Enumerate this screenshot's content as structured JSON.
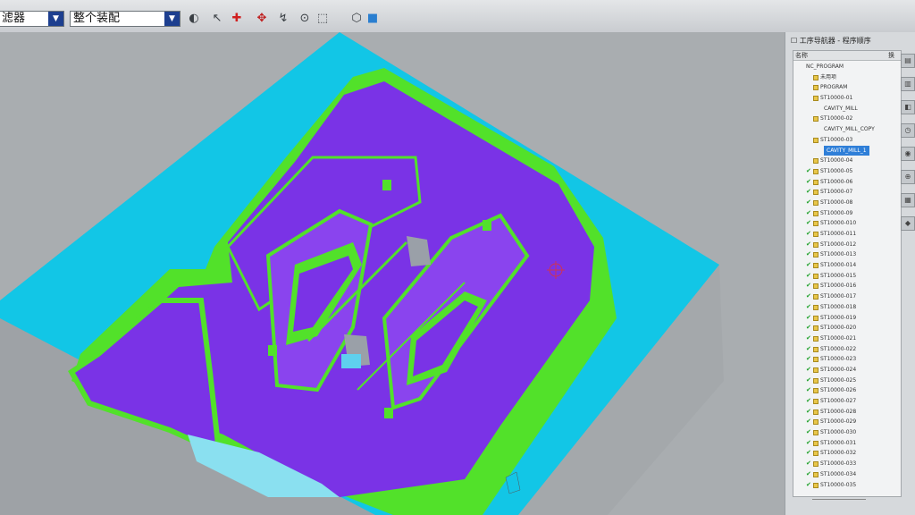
{
  "toolbar": {
    "filter_combo": "选择过滤器",
    "filter_combo_visible": "滤器",
    "scope_combo": "整个装配"
  },
  "icons": [
    "render-icon",
    "select-arrow-icon",
    "snap-point-icon",
    "move-icon",
    "snap-icon",
    "view-center-icon",
    "box-select-icon",
    "view-cube-icon"
  ],
  "navigator": {
    "title": "工序导航器 - 程序顺序",
    "col_name": "名称",
    "col_flag": "换",
    "rows": [
      {
        "label": "NC_PROGRAM",
        "indent": 0,
        "check": "",
        "folder": false
      },
      {
        "label": "未用项",
        "indent": 1,
        "check": "",
        "folder": true
      },
      {
        "label": "PROGRAM",
        "indent": 1,
        "check": "",
        "folder": true
      },
      {
        "label": "ST10000-01",
        "indent": 1,
        "check": "",
        "folder": true
      },
      {
        "label": "CAVITY_MILL",
        "indent": 2,
        "check": "",
        "folder": false
      },
      {
        "label": "ST10000-02",
        "indent": 1,
        "check": "",
        "folder": true
      },
      {
        "label": "CAVITY_MILL_COPY",
        "indent": 2,
        "check": "",
        "folder": false
      },
      {
        "label": "ST10000-03",
        "indent": 1,
        "check": "",
        "folder": true
      },
      {
        "label": "CAVITY_MILL_1",
        "indent": 2,
        "check": "",
        "folder": false,
        "selected": true
      },
      {
        "label": "ST10000-04",
        "indent": 1,
        "check": "",
        "folder": true
      },
      {
        "label": "ST10000-05",
        "indent": 1,
        "check": "✔",
        "folder": true
      },
      {
        "label": "ST10000-06",
        "indent": 1,
        "check": "✔",
        "folder": true
      },
      {
        "label": "ST10000-07",
        "indent": 1,
        "check": "✔",
        "folder": true
      },
      {
        "label": "ST10000-08",
        "indent": 1,
        "check": "✔",
        "folder": true
      },
      {
        "label": "ST10000-09",
        "indent": 1,
        "check": "✔",
        "folder": true
      },
      {
        "label": "ST10000-010",
        "indent": 1,
        "check": "✔",
        "folder": true
      },
      {
        "label": "ST10000-011",
        "indent": 1,
        "check": "✔",
        "folder": true
      },
      {
        "label": "ST10000-012",
        "indent": 1,
        "check": "✔",
        "folder": true
      },
      {
        "label": "ST10000-013",
        "indent": 1,
        "check": "✔",
        "folder": true
      },
      {
        "label": "ST10000-014",
        "indent": 1,
        "check": "✔",
        "folder": true
      },
      {
        "label": "ST10000-015",
        "indent": 1,
        "check": "✔",
        "folder": true
      },
      {
        "label": "ST10000-016",
        "indent": 1,
        "check": "✔",
        "folder": true
      },
      {
        "label": "ST10000-017",
        "indent": 1,
        "check": "✔",
        "folder": true
      },
      {
        "label": "ST10000-018",
        "indent": 1,
        "check": "✔",
        "folder": true
      },
      {
        "label": "ST10000-019",
        "indent": 1,
        "check": "✔",
        "folder": true
      },
      {
        "label": "ST10000-020",
        "indent": 1,
        "check": "✔",
        "folder": true
      },
      {
        "label": "ST10000-021",
        "indent": 1,
        "check": "✔",
        "folder": true
      },
      {
        "label": "ST10000-022",
        "indent": 1,
        "check": "✔",
        "folder": true
      },
      {
        "label": "ST10000-023",
        "indent": 1,
        "check": "✔",
        "folder": true
      },
      {
        "label": "ST10000-024",
        "indent": 1,
        "check": "✔",
        "folder": true
      },
      {
        "label": "ST10000-025",
        "indent": 1,
        "check": "✔",
        "folder": true
      },
      {
        "label": "ST10000-026",
        "indent": 1,
        "check": "✔",
        "folder": true
      },
      {
        "label": "ST10000-027",
        "indent": 1,
        "check": "✔",
        "folder": true
      },
      {
        "label": "ST10000-028",
        "indent": 1,
        "check": "✔",
        "folder": true
      },
      {
        "label": "ST10000-029",
        "indent": 1,
        "check": "✔",
        "folder": true
      },
      {
        "label": "ST10000-030",
        "indent": 1,
        "check": "✔",
        "folder": true
      },
      {
        "label": "ST10000-031",
        "indent": 1,
        "check": "✔",
        "folder": true
      },
      {
        "label": "ST10000-032",
        "indent": 1,
        "check": "✔",
        "folder": true
      },
      {
        "label": "ST10000-033",
        "indent": 1,
        "check": "✔",
        "folder": true
      },
      {
        "label": "ST10000-034",
        "indent": 1,
        "check": "✔",
        "folder": true
      },
      {
        "label": "ST10000-035",
        "indent": 1,
        "check": "✔",
        "folder": true
      }
    ]
  },
  "colors": {
    "plate": "#12c6e6",
    "floor": "#7a33e6",
    "wall": "#52e12a",
    "background": "#a9adb0",
    "selection": "#2f7fd8"
  }
}
